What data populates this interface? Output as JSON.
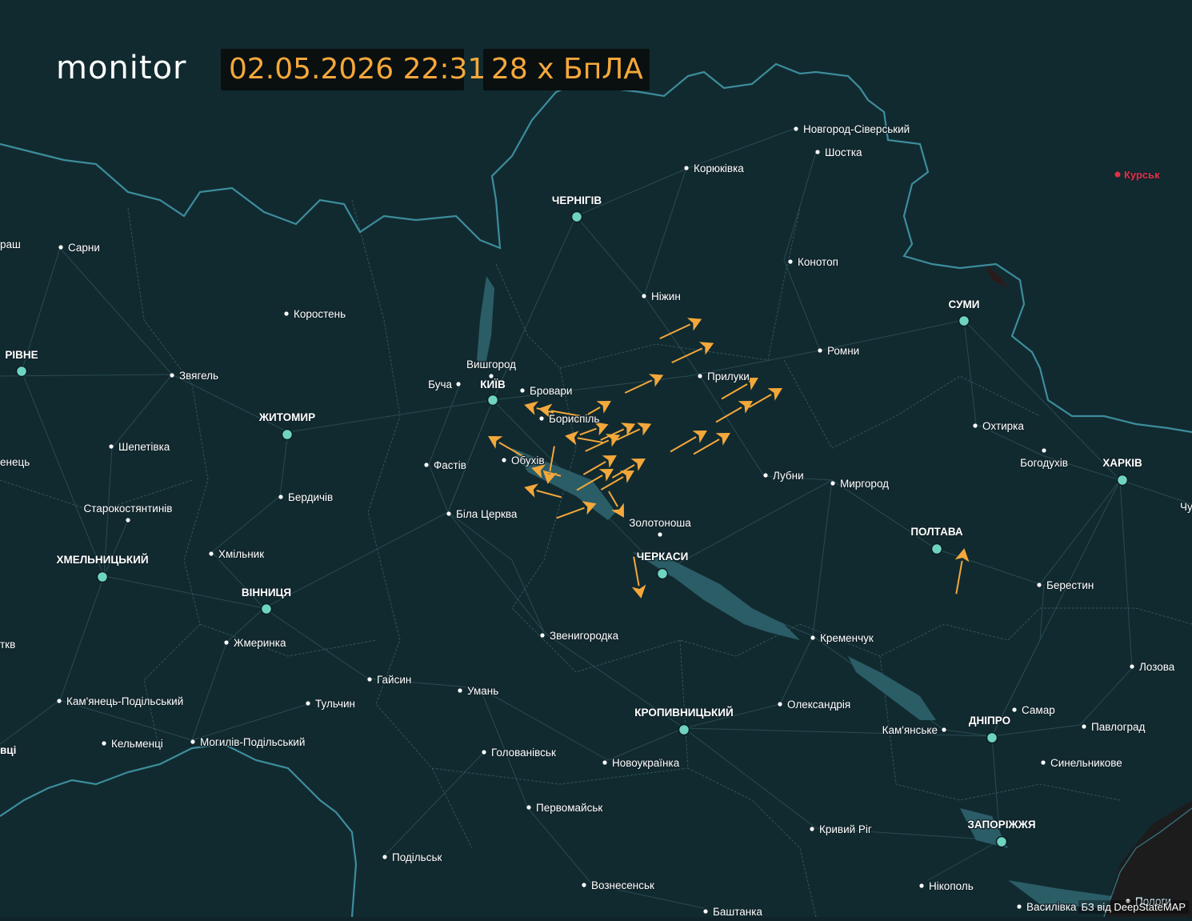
{
  "header": {
    "logo": "monitor",
    "timestamp": "02.05.2026 22:31",
    "count": "28 х БпЛА"
  },
  "credit": "БЗ від DeepStateMAP",
  "colors": {
    "background": "#112a30",
    "border": "#3f8fa0",
    "roads": "#2c4c53",
    "water": "#2a5a64",
    "city_dot": "#6fd3c2",
    "drone": "#f4a83a",
    "hud_text": "#f4a83a",
    "russia_city": "#e0304a"
  },
  "cities_major": [
    {
      "name": "ЧЕРНІГІВ"
    },
    {
      "name": "КИЇВ"
    },
    {
      "name": "СУМИ"
    },
    {
      "name": "РІВНЕ"
    },
    {
      "name": "ЖИТОМИР"
    },
    {
      "name": "ХАРКІВ"
    },
    {
      "name": "ПОЛТАВА"
    },
    {
      "name": "ЧЕРКАСИ"
    },
    {
      "name": "ХМЕЛЬНИЦЬКИЙ"
    },
    {
      "name": "ВІННИЦЯ"
    },
    {
      "name": "КРОПИВНИЦЬКИЙ"
    },
    {
      "name": "ДНІПРО"
    },
    {
      "name": "ЗАПОРІЖЖЯ"
    }
  ],
  "cities_minor": [
    {
      "name": "Новгород-Сіверський"
    },
    {
      "name": "Шостка"
    },
    {
      "name": "Корюківка"
    },
    {
      "name": "Сарни"
    },
    {
      "name": "Конотоп"
    },
    {
      "name": "Ніжин"
    },
    {
      "name": "Коростень"
    },
    {
      "name": "Ромни"
    },
    {
      "name": "Вишгород"
    },
    {
      "name": "Прилуки"
    },
    {
      "name": "Звягель"
    },
    {
      "name": "Буча"
    },
    {
      "name": "Бровари"
    },
    {
      "name": "Бориспіль"
    },
    {
      "name": "Охтирка"
    },
    {
      "name": "Шепетівка"
    },
    {
      "name": "Обухів"
    },
    {
      "name": "Фастів"
    },
    {
      "name": "Богодухів"
    },
    {
      "name": "Лубни"
    },
    {
      "name": "Миргород"
    },
    {
      "name": "Бердичів"
    },
    {
      "name": "Старокостянтинів"
    },
    {
      "name": "Біла Церква"
    },
    {
      "name": "Золотоноша"
    },
    {
      "name": "Хмільник"
    },
    {
      "name": "Берестин"
    },
    {
      "name": "Жмеринка"
    },
    {
      "name": "Звенигородка"
    },
    {
      "name": "Кременчук"
    },
    {
      "name": "Лозова"
    },
    {
      "name": "Гайсин"
    },
    {
      "name": "Умань"
    },
    {
      "name": "Кам'янець-Подільський"
    },
    {
      "name": "Тульчин"
    },
    {
      "name": "Олександрія"
    },
    {
      "name": "Самар"
    },
    {
      "name": "Кам'янське"
    },
    {
      "name": "Павлоград"
    },
    {
      "name": "Кельменці"
    },
    {
      "name": "Могилів-Подільський"
    },
    {
      "name": "Голованівськ"
    },
    {
      "name": "Новоукраїнка"
    },
    {
      "name": "Синельникове"
    },
    {
      "name": "Первомайськ"
    },
    {
      "name": "Кривий Ріг"
    },
    {
      "name": "Подільськ"
    },
    {
      "name": "Вознесенськ"
    },
    {
      "name": "Нікополь"
    },
    {
      "name": "Баштанка"
    },
    {
      "name": "Василівка"
    },
    {
      "name": "Пологи"
    }
  ],
  "cities_foreign": [
    {
      "name": "Курськ"
    }
  ],
  "edge_fragments": [
    {
      "name": "раш"
    },
    {
      "name": "енець"
    },
    {
      "name": "ткв"
    },
    {
      "name": "вці"
    },
    {
      "name": "Чу"
    }
  ],
  "drone_count": 28
}
